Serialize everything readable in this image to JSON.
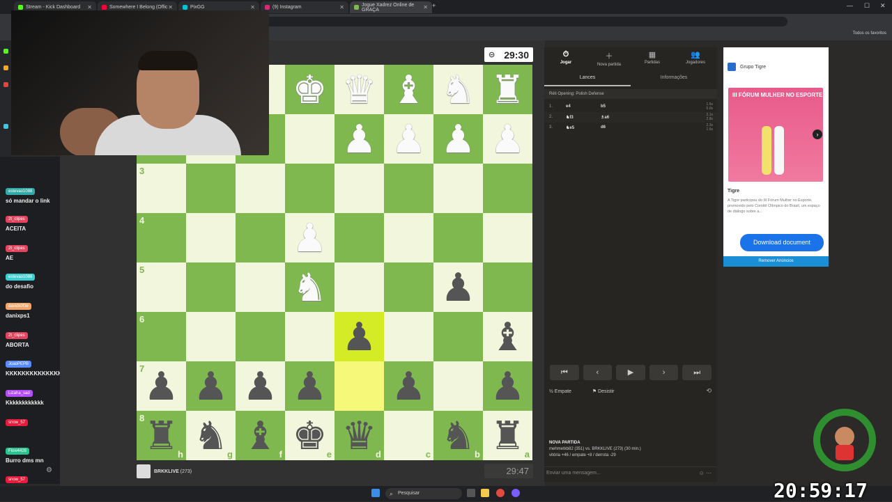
{
  "browser": {
    "tabs": [
      {
        "label": "Stream - Kick Dashboard",
        "color": "#53fc18"
      },
      {
        "label": "Somewhere I Belong (Offic",
        "color": "#ff0033"
      },
      {
        "label": "PixGG",
        "color": "#00c2d1"
      },
      {
        "label": "(9) Instagram",
        "color": "#d62976"
      },
      {
        "label": "Jogue Xadrez Online de GRAÇA",
        "color": "#7fb84f"
      }
    ],
    "new_tab": "+",
    "favorites": "Todos os favoritos"
  },
  "chat": [
    {
      "user": "estevao1088",
      "text": "só mandar o link",
      "color": "#3aa"
    },
    {
      "user": "2t_clipes",
      "text": "ACEITA",
      "color": "#e5445e"
    },
    {
      "user": "2t_clipes",
      "text": "AE",
      "color": "#e5445e"
    },
    {
      "user": "estevao1088",
      "text": "do desafio",
      "color": "#3ccfcf"
    },
    {
      "user": "davidk0f3e",
      "text": "danixps1",
      "color": "#f2a66a"
    },
    {
      "user": "2t_clipes",
      "text": "ABORTA",
      "color": "#e5445e"
    },
    {
      "user": "JoaoPEPB",
      "text": "KKKKKKKKKKKKKK",
      "color": "#5b8cff"
    },
    {
      "user": "Lizaha_sad",
      "text": "Kkkkkkkkkkkk",
      "color": "#b44cff"
    },
    {
      "user": "snow_57",
      "text": "",
      "color": "#e51c3b"
    },
    {
      "user": "Flow4426",
      "text": "Burro dms mn",
      "color": "#29c48f"
    },
    {
      "user": "snow_57",
      "text": "",
      "color": "#e51c3b"
    }
  ],
  "game": {
    "top_clock": "29:30",
    "bottom_clock": "29:47",
    "player": "BRKKLIVE",
    "player_rating": "(273)",
    "ranks": [
      "3",
      "4",
      "5",
      "6",
      "7",
      "8"
    ],
    "files": [
      "h",
      "g",
      "f",
      "e",
      "d",
      "c",
      "b",
      "a"
    ],
    "board": [
      [
        "",
        "",
        "",
        "wK",
        "wQ",
        "wB",
        "wN",
        "wR"
      ],
      [
        "",
        "",
        "",
        "",
        "wP",
        "wP",
        "wP",
        "wP"
      ],
      [
        "",
        "",
        "",
        "",
        "",
        "",
        "",
        ""
      ],
      [
        "",
        "",
        "",
        "wP",
        "",
        "",
        "",
        ""
      ],
      [
        "",
        "",
        "",
        "wN",
        "",
        "",
        "bP",
        ""
      ],
      [
        "",
        "",
        "",
        "",
        "bP",
        "",
        "",
        "bB"
      ],
      [
        "bP",
        "bP",
        "bP",
        "bP",
        "",
        "bP",
        "",
        "bP"
      ],
      [
        "bR",
        "bN",
        "bB",
        "bK",
        "bQ",
        "",
        "bN",
        "bR"
      ]
    ]
  },
  "panel": {
    "nav": [
      {
        "label": "Jogar",
        "icon": "⏱"
      },
      {
        "label": "Nova partida",
        "icon": "＋"
      },
      {
        "label": "Partidas",
        "icon": "▦"
      },
      {
        "label": "Jogadores",
        "icon": "👥"
      }
    ],
    "tabs": [
      "Lances",
      "Informações"
    ],
    "opening": "Réti Opening: Polish Defense",
    "moves": [
      {
        "n": "1.",
        "white": "e4",
        "black": "b5",
        "t1": "1.5s",
        "t2": "5.0s"
      },
      {
        "n": "2.",
        "white": "♞f3",
        "black": "♗a6",
        "t1": "2.1s",
        "t2": "2.8s"
      },
      {
        "n": "3.",
        "white": "♞e5",
        "black": "d6",
        "t1": "2.3s",
        "t2": "1.5s"
      }
    ],
    "controls": [
      "⏮",
      "‹",
      "▶",
      "›",
      "⏭"
    ],
    "draw": "Empate",
    "resign": "Desistir",
    "new_game_title": "NOVA PARTIDA",
    "new_game_line": "mehmetkb82 (351) vs. BRKKLIVE (273) (30 min.)",
    "new_game_stats": "vitória +46 / empate +8 / derrota -29",
    "message_placeholder": "Enviar uma mensagem..."
  },
  "ad": {
    "brand": "Grupo Tigre",
    "image_text": "III FÓRUM MULHER NO ESPORTE",
    "title": "Tigre",
    "description": "A Tigre participou do III Fórum Mulher no Esporte, promovido pelo Comitê Olímpico do Brasil, um espaço de diálogo sobre a...",
    "cta": "Download document",
    "remove": "Remover Anúncios"
  },
  "taskbar": {
    "search": "Pesquisar"
  },
  "stream_overlay": {
    "clock": "20:59:17"
  }
}
